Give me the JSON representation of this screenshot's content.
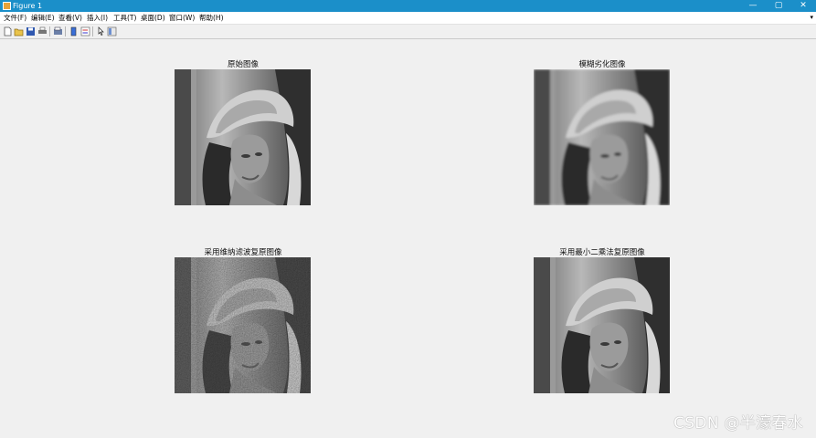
{
  "window": {
    "title": "Figure 1",
    "minimize": "—",
    "maximize": "▢",
    "close": "✕"
  },
  "menu": {
    "items": [
      "文件(F)",
      "编辑(E)",
      "查看(V)",
      "插入(I)",
      "工具(T)",
      "桌面(D)",
      "窗口(W)",
      "帮助(H)"
    ],
    "overflow": "▾"
  },
  "toolbar": {
    "icons": [
      "new-figure-icon",
      "open-file-icon",
      "save-icon",
      "print-icon",
      "print-preview-icon",
      "colorbar-icon",
      "legend-icon",
      "pointer-icon",
      "property-editor-icon"
    ]
  },
  "plots": [
    {
      "title": "原始图像",
      "variant": "original"
    },
    {
      "title": "模糊劣化图像",
      "variant": "blurred"
    },
    {
      "title": "采用维纳滤波复原图像",
      "variant": "noisy"
    },
    {
      "title": "采用最小二乘法复原图像",
      "variant": "restored"
    }
  ],
  "watermark": "CSDN @半濠春水"
}
